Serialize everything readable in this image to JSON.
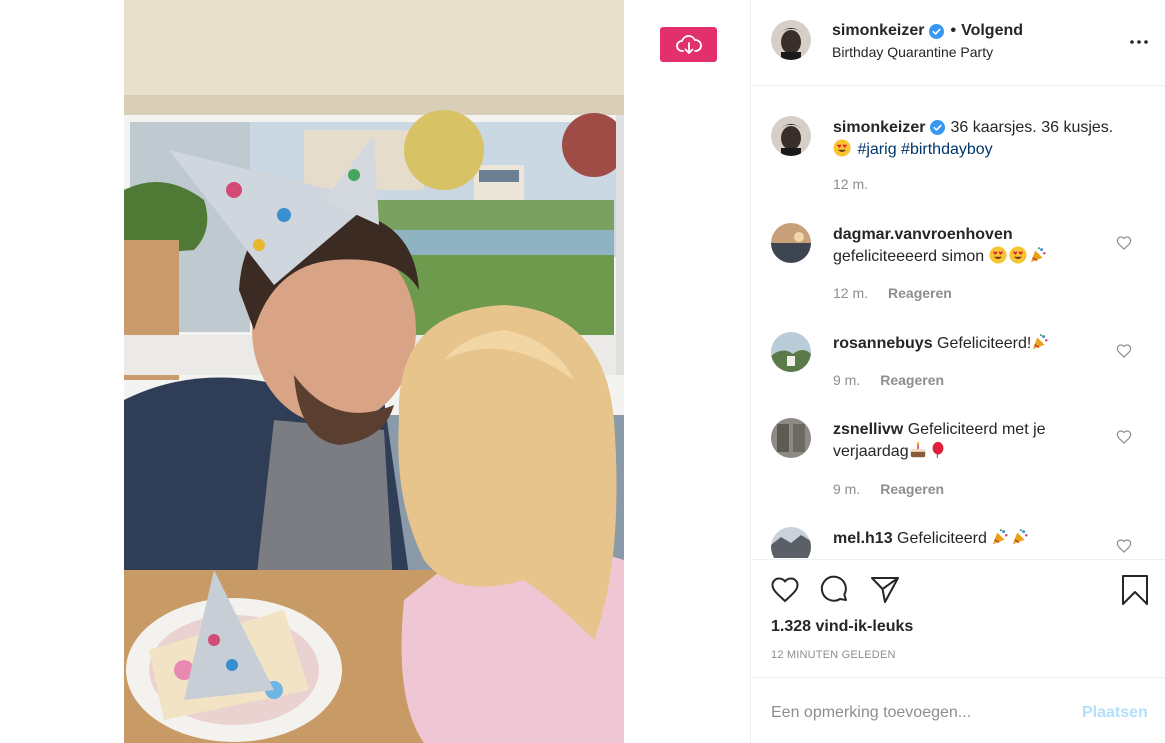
{
  "header": {
    "username": "simonkeizer",
    "verified": true,
    "separator": "•",
    "follow_label": "Volgend",
    "location": "Birthday Quarantine Party",
    "more_icon": "more-horizontal-icon"
  },
  "photo": {
    "download_icon": "cloud-download-icon",
    "accent": "#e1306c"
  },
  "caption": {
    "username": "simonkeizer",
    "verified": true,
    "text": "36 kaarsjes. 36 kusjes.",
    "emoji": "heart-eyes-emoji",
    "tags": [
      "#jarig",
      "#birthdayboy"
    ],
    "time": "12 m."
  },
  "comments": [
    {
      "username": "dagmar.vanvroenhoven",
      "text": "gefeliciteeeerd simon",
      "emojis": [
        "heart-eyes-emoji",
        "heart-eyes-emoji",
        "party-popper-emoji"
      ],
      "time": "12 m.",
      "reply_label": "Reageren"
    },
    {
      "username": "rosannebuys",
      "text": "Gefeliciteerd!",
      "emojis": [
        "party-popper-emoji"
      ],
      "time": "9 m.",
      "reply_label": "Reageren"
    },
    {
      "username": "zsnellivw",
      "text": "Gefeliciteerd met je",
      "text2": "verjaardag",
      "emojis": [
        "cake-emoji",
        "balloon-emoji"
      ],
      "time": "9 m.",
      "reply_label": "Reageren"
    },
    {
      "username": "mel.h13",
      "text": "Gefeliciteerd",
      "emojis": [
        "party-popper-emoji",
        "party-popper-emoji"
      ]
    }
  ],
  "actions": {
    "like_icon": "heart-icon",
    "comment_icon": "comment-icon",
    "share_icon": "send-icon",
    "save_icon": "bookmark-icon",
    "likes": "1.328 vind-ik-leuks",
    "timestamp": "12 minuten geleden"
  },
  "compose": {
    "placeholder": "Een opmerking toevoegen...",
    "post_label": "Plaatsen",
    "post_color": "#b2dffc"
  }
}
